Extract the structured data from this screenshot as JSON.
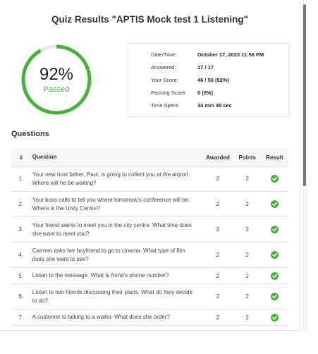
{
  "title": "Quiz Results \"APTIS Mock test 1 Listening\"",
  "score": {
    "percent": "92%",
    "percent_value": 0.92,
    "status": "Passed"
  },
  "info": [
    {
      "label": "Date/Time:",
      "value": "October 17, 2023 11:56 PM"
    },
    {
      "label": "Answered:",
      "value": "17 / 17"
    },
    {
      "label": "Your Score:",
      "value": "46 / 50 (92%)"
    },
    {
      "label": "Passing Score:",
      "value": "0 (0%)"
    },
    {
      "label": "Time Spent:",
      "value": "34 min 49 sec"
    }
  ],
  "questions_heading": "Questions",
  "table": {
    "headers": {
      "num": "#",
      "question": "Question",
      "awarded": "Awarded",
      "points": "Points",
      "result": "Result"
    },
    "rows": [
      {
        "num": "1.",
        "question": "Your new host father, Paul, is going to collect you at the airport. Where will he be waiting?",
        "awarded": "2",
        "points": "2",
        "result": "check-icon"
      },
      {
        "num": "2.",
        "question": "Your boss calls to tell you where tomorrow's conference will be. Where is the Unity Centre?",
        "awarded": "2",
        "points": "2",
        "result": "check-icon"
      },
      {
        "num": "3.",
        "question": "Your friend wants to meet you in the city centre. What time does she want to meet you?",
        "awarded": "2",
        "points": "2",
        "result": "check-icon"
      },
      {
        "num": "4.",
        "question": "Carmen asks her boyfriend to go to cinema. What type of film does she want to see?",
        "awarded": "2",
        "points": "2",
        "result": "check-icon"
      },
      {
        "num": "5.",
        "question": "Listen to the message. What is Anna's phone number?",
        "awarded": "2",
        "points": "2",
        "result": "check-icon"
      },
      {
        "num": "6.",
        "question": "Listen to two friends discussing their plans. What do they decide to do?",
        "awarded": "2",
        "points": "2",
        "result": "check-icon"
      },
      {
        "num": "7.",
        "question": "A customer is talking to a waiter. What does she order?",
        "awarded": "2",
        "points": "2",
        "result": "check-icon"
      }
    ]
  },
  "colors": {
    "pass_green": "#47b33a",
    "ring_track": "#e8e8e8"
  }
}
